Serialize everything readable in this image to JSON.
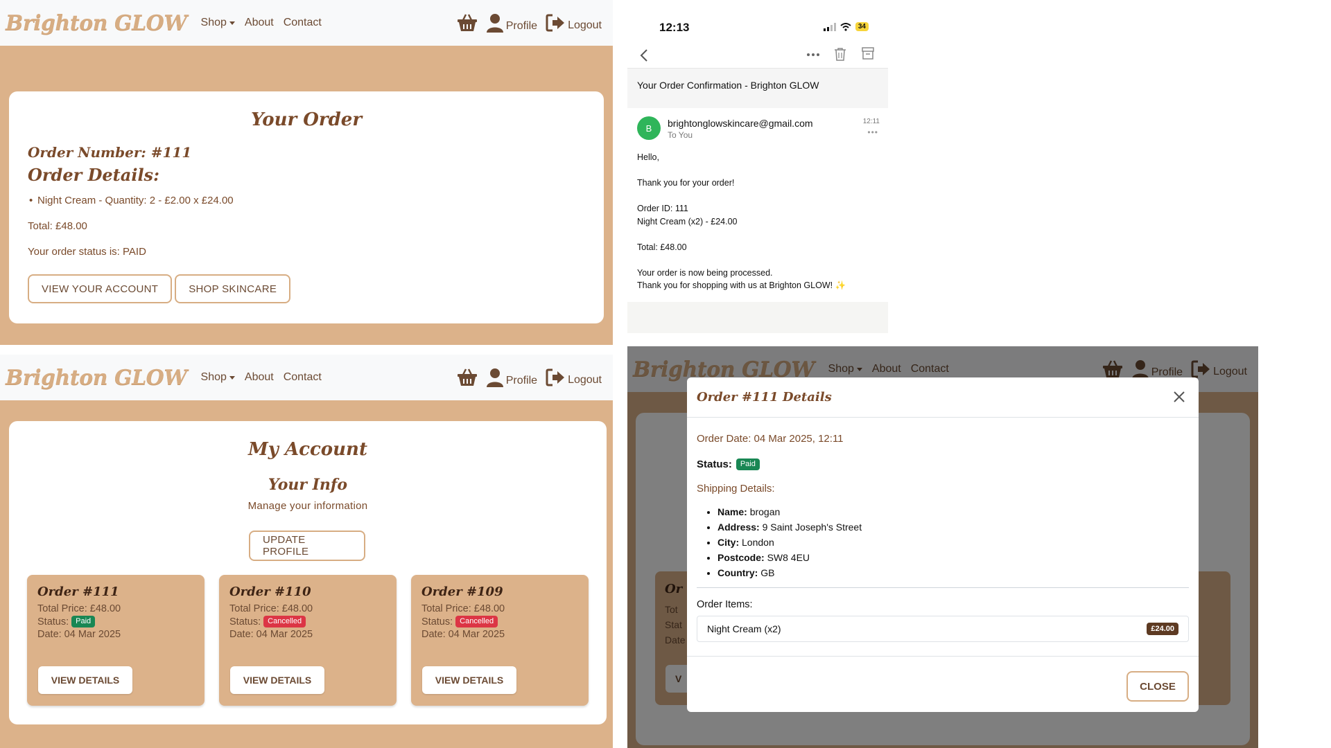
{
  "nav": {
    "brand": "Brighton GLOW",
    "shop": "Shop",
    "about": "About",
    "contact": "Contact",
    "profile": "Profile",
    "logout": "Logout"
  },
  "your_order": {
    "title": "Your Order",
    "order_number": "Order Number: #111",
    "details_heading": "Order Details:",
    "item": "Night Cream - Quantity: 2 - £2.00 x £24.00",
    "total": "Total: £48.00",
    "status": "Your order status is: PAID",
    "view_account_btn": "VIEW YOUR ACCOUNT",
    "shop_skincare_btn": "SHOP SKINCARE"
  },
  "email": {
    "time": "12:13",
    "battery": "34",
    "subject": "Your Order Confirmation - Brighton GLOW",
    "avatar_letter": "B",
    "sender": "brightonglowskincare@gmail.com",
    "to": "To You",
    "sent_time": "12:11",
    "body_lines": [
      "Hello,",
      "",
      "Thank you for your order!",
      "",
      "Order ID: 111",
      "Night Cream (x2) - £24.00",
      "",
      "Total: £48.00",
      "",
      "Your order is now being processed.",
      "Thank you for shopping with us at Brighton GLOW! ✨"
    ]
  },
  "account": {
    "title": "My Account",
    "info_heading": "Your Info",
    "manage": "Manage your information",
    "update_btn": "UPDATE PROFILE",
    "orders": [
      {
        "title": "Order #111",
        "total": "Total Price: £48.00",
        "status_label": "Status:",
        "status": "Paid",
        "date": "Date: 04 Mar 2025",
        "btn": "VIEW DETAILS"
      },
      {
        "title": "Order #110",
        "total": "Total Price: £48.00",
        "status_label": "Status:",
        "status": "Cancelled",
        "date": "Date: 04 Mar 2025",
        "btn": "VIEW DETAILS"
      },
      {
        "title": "Order #109",
        "total": "Total Price: £48.00",
        "status_label": "Status:",
        "status": "Cancelled",
        "date": "Date: 04 Mar 2025",
        "btn": "VIEW DETAILS"
      }
    ]
  },
  "modal": {
    "title": "Order #111 Details",
    "order_date": "Order Date: 04 Mar 2025, 12:11",
    "status_label": "Status:",
    "status": "Paid",
    "shipping_heading": "Shipping Details:",
    "shipping": {
      "name_label": "Name:",
      "name": "brogan",
      "address_label": "Address:",
      "address": "9 Saint Joseph's Street",
      "city_label": "City:",
      "city": "London",
      "postcode_label": "Postcode:",
      "postcode": "SW8 4EU",
      "country_label": "Country:",
      "country": "GB"
    },
    "items_heading": "Order Items:",
    "item_name": "Night Cream (x2)",
    "item_price": "£24.00",
    "close_btn": "CLOSE",
    "bg_tile_title": "Or",
    "bg_tile_lines": [
      "Tot",
      "Stat",
      "Date"
    ],
    "bg_tile_btn": "V"
  },
  "colors": {
    "brand_tan": "#dcb28a",
    "brand_brown": "#7a4a2a",
    "paid_green": "#198754",
    "cancelled_red": "#dc3545"
  }
}
